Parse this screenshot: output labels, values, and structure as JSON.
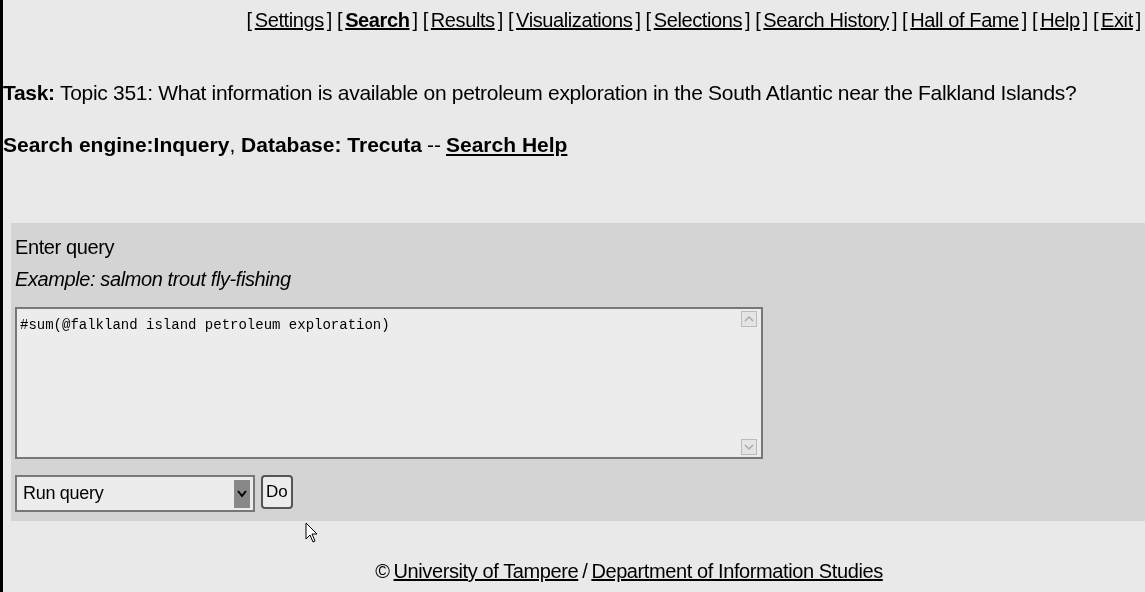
{
  "nav": [
    {
      "open": "[",
      "label": "Settings",
      "close": "]",
      "selected": false
    },
    {
      "open": "[",
      "label": "Search",
      "close": "]",
      "selected": true
    },
    {
      "open": "[",
      "label": "Results",
      "close": "]",
      "selected": false
    },
    {
      "open": "[",
      "label": "Visualizations",
      "close": "]",
      "selected": false
    },
    {
      "open": "[",
      "label": "Selections",
      "close": "]",
      "selected": false
    },
    {
      "open": "[",
      "label": "Search History",
      "close": "]",
      "selected": false
    },
    {
      "open": "[",
      "label": "Hall of Fame",
      "close": "]",
      "selected": false
    },
    {
      "open": "[",
      "label": "Help",
      "close": "]",
      "selected": false
    },
    {
      "open": "[",
      "label": "Exit",
      "close": "]",
      "selected": false
    }
  ],
  "task": "**Task:** Topic 351: What information is available on petroleum exploration in the South Atlantic near the Falkland Islands?",
  "engine": {
    "text": "**Search engine:Inquery**, **Database: Trecuta**",
    "separator": "--",
    "help_link": "Search Help"
  },
  "query_panel": {
    "label": "Enter query",
    "example": "Example: salmon trout fly-fishing",
    "query": "#sum(@falkland island petroleum exploration)",
    "action": "Run query",
    "button": "Do"
  },
  "footer": {
    "copyright": "©",
    "university": "University of Tampere",
    "separator": "/",
    "department": "Department of Information Studies"
  }
}
